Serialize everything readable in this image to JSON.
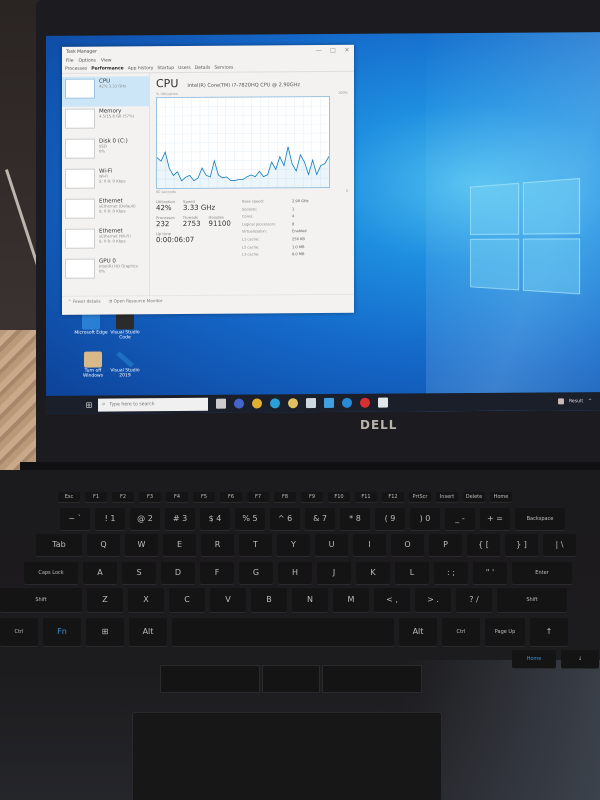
{
  "scene": {
    "description": "Photo of a Dell laptop showing Windows 10 Task Manager Performance tab",
    "brand_logo": "DELL"
  },
  "task_manager": {
    "title": "Task Manager",
    "window_controls": [
      "—",
      "□",
      "✕"
    ],
    "menu": [
      "File",
      "Options",
      "View"
    ],
    "tabs": [
      "Processes",
      "Performance",
      "App history",
      "Startup",
      "Users",
      "Details",
      "Services"
    ],
    "active_tab": "Performance",
    "sidebar": [
      {
        "name": "CPU",
        "sub1": "42%  3.33 GHz",
        "sub2": "",
        "selected": true
      },
      {
        "name": "Memory",
        "sub1": "4.5/15.8 GB (57%)",
        "sub2": "",
        "selected": false
      },
      {
        "name": "Disk 0 (C:)",
        "sub1": "SSD",
        "sub2": "0%",
        "selected": false
      },
      {
        "name": "Wi-Fi",
        "sub1": "Wi-Fi",
        "sub2": "S: 0  R: 0 Kbps",
        "selected": false
      },
      {
        "name": "Ethernet",
        "sub1": "vEthernet (Default)",
        "sub2": "S: 0  R: 0 Kbps",
        "selected": false
      },
      {
        "name": "Ethernet",
        "sub1": "vEthernet (Wi-Fi)",
        "sub2": "S: 0  R: 0 Kbps",
        "selected": false
      },
      {
        "name": "GPU 0",
        "sub1": "Intel(R) HD Graphics",
        "sub2": "0%",
        "selected": false
      }
    ],
    "main": {
      "title": "CPU",
      "model": "Intel(R) Core(TM) i7-7820HQ CPU @ 2.90GHz",
      "graph_ylabel": "% Utilization",
      "graph_ymax": "100%",
      "graph_xlabel": "60 seconds",
      "graph_xmin": "0",
      "utilization_samples_pct": [
        34,
        30,
        40,
        22,
        14,
        18,
        8,
        12,
        14,
        8,
        11,
        22,
        14,
        12,
        30,
        14,
        11,
        12,
        8,
        8,
        9,
        9,
        12,
        14,
        12,
        18,
        12,
        14,
        28,
        20,
        34,
        24,
        45,
        26,
        18,
        36,
        28,
        14,
        30,
        14,
        24,
        26,
        34
      ],
      "stats": {
        "utilization_label": "Utilization",
        "utilization": "42%",
        "speed_label": "Speed",
        "speed": "3.33 GHz",
        "processes_label": "Processes",
        "processes": "232",
        "threads_label": "Threads",
        "threads": "2753",
        "handles_label": "Handles",
        "handles": "91100",
        "uptime_label": "Up time",
        "uptime": "0:00:06:07"
      },
      "specs": [
        {
          "k": "Base speed:",
          "v": "2.90 GHz"
        },
        {
          "k": "Sockets:",
          "v": "1"
        },
        {
          "k": "Cores:",
          "v": "4"
        },
        {
          "k": "Logical processors:",
          "v": "8"
        },
        {
          "k": "Virtualization:",
          "v": "Enabled"
        },
        {
          "k": "L1 cache:",
          "v": "256 KB"
        },
        {
          "k": "L2 cache:",
          "v": "1.0 MB"
        },
        {
          "k": "L3 cache:",
          "v": "8.0 MB"
        }
      ]
    },
    "footer": {
      "fewer_details": "Fewer details",
      "open_resource_monitor": "Open Resource Monitor"
    }
  },
  "desktop": {
    "icons": [
      {
        "label": "Microsoft Edge",
        "icon": "edge-icon",
        "color": "#2a7fd4"
      },
      {
        "label": "Visual Studio Code",
        "icon": "terminal-icon",
        "color": "#2b2b2b"
      },
      {
        "label": "Turn off Windows",
        "icon": "folder-icon",
        "color": "#d7b98a"
      },
      {
        "label": "Visual Studio 2019",
        "icon": "vs-icon",
        "color": "#1e6fc0"
      }
    ]
  },
  "taskbar": {
    "search_placeholder": "Type here to search",
    "tray_text": "Result",
    "pinned": [
      {
        "icon": "task-view-icon",
        "color": "#cccccc"
      },
      {
        "icon": "app-icon",
        "color": "#4466cc"
      },
      {
        "icon": "chrome-icon",
        "color": "#e0b030"
      },
      {
        "icon": "edge-icon",
        "color": "#2aa0d8"
      },
      {
        "icon": "explorer-icon",
        "color": "#e0c060"
      },
      {
        "icon": "store-icon",
        "color": "#cfd8e0"
      },
      {
        "icon": "mail-icon",
        "color": "#40a0e0"
      },
      {
        "icon": "vscode-icon",
        "color": "#2a8ad8"
      },
      {
        "icon": "opera-icon",
        "color": "#d83030"
      },
      {
        "icon": "task-manager-icon",
        "color": "#dfe6ea"
      }
    ]
  },
  "keyboard": {
    "function_row": [
      "Esc",
      "F1",
      "F2",
      "F3",
      "F4",
      "F5",
      "F6",
      "F7",
      "F8",
      "F9",
      "F10",
      "F11",
      "F12",
      "PrtScr",
      "Insert",
      "Delete",
      "Home"
    ],
    "number_row": [
      "~ `",
      "! 1",
      "@ 2",
      "# 3",
      "$ 4",
      "% 5",
      "^ 6",
      "& 7",
      "* 8",
      "( 9",
      ") 0",
      "_ -",
      "+ =",
      "Backspace"
    ],
    "top_row": [
      "Tab",
      "Q",
      "W",
      "E",
      "R",
      "T",
      "Y",
      "U",
      "I",
      "O",
      "P",
      "{ [",
      "} ]",
      "| \\"
    ],
    "home_row": [
      "Caps Lock",
      "A",
      "S",
      "D",
      "F",
      "G",
      "H",
      "J",
      "K",
      "L",
      ": ;",
      "\" '",
      "Enter"
    ],
    "bottom_row": [
      "Shift",
      "Z",
      "X",
      "C",
      "V",
      "B",
      "N",
      "M",
      "< ,",
      "> .",
      "? /",
      "Shift"
    ],
    "modifier_row": [
      "Ctrl",
      "Fn",
      "Win",
      "Alt",
      "",
      "Alt",
      "Ctrl",
      "Page Up",
      "↑"
    ],
    "arrow_row": [
      "Home",
      "↓"
    ]
  }
}
